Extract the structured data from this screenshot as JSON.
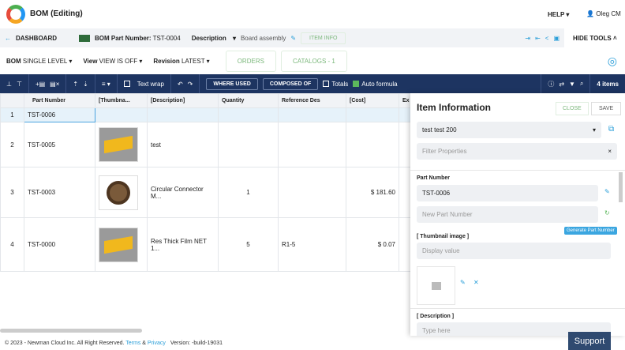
{
  "app": {
    "title": "BOM (Editing)",
    "help": "HELP",
    "user": "Oleg CM"
  },
  "nav": {
    "dashboard": "DASHBOARD",
    "bom_part_label": "BOM Part Number:",
    "bom_part_value": "TST-0004",
    "description_label": "Description",
    "description_value": "Board assembly",
    "item_info": "ITEM INFO",
    "hide_tools": "HIDE TOOLS"
  },
  "filters": {
    "bom_label": "BOM",
    "bom_value": "SINGLE LEVEL",
    "view_label": "View",
    "view_value": "VIEW IS OFF",
    "revision_label": "Revision",
    "revision_value": "LATEST",
    "orders": "ORDERS",
    "catalogs": "CATALOGS - 1"
  },
  "toolbar": {
    "text_wrap": "Text wrap",
    "where_used": "WHERE USED",
    "composed_of": "COMPOSED OF",
    "totals": "Totals",
    "auto_formula": "Auto formula",
    "items_count": "4 items"
  },
  "table": {
    "headers": [
      "",
      "Part Number",
      "[Thumbna...",
      "[Description]",
      "Quantity",
      "Reference Des",
      "[Cost]",
      "Ex"
    ],
    "rows": [
      {
        "n": "1",
        "part": "TST-0006",
        "thumb": "",
        "desc": "",
        "qty": "",
        "ref": "",
        "cost": ""
      },
      {
        "n": "2",
        "part": "TST-0005",
        "thumb": "chip",
        "desc": "test",
        "qty": "",
        "ref": "",
        "cost": ""
      },
      {
        "n": "3",
        "part": "TST-0003",
        "thumb": "connector",
        "desc": "Circular Connector M...",
        "qty": "1",
        "ref": "",
        "cost": "$ 181.60"
      },
      {
        "n": "4",
        "part": "TST-0000",
        "thumb": "chip",
        "desc": "Res Thick Film NET 1...",
        "qty": "5",
        "ref": "R1-5",
        "cost": "$ 0.07"
      }
    ]
  },
  "panel": {
    "title": "Item Information",
    "close": "CLOSE",
    "save": "SAVE",
    "selected": "test test 200",
    "filter_placeholder": "Filter Properties",
    "part_number_label": "Part Number",
    "part_number_value": "TST-0006",
    "new_part_placeholder": "New Part Number",
    "generate_tooltip": "Generate Part Number",
    "thumbnail_label": "[ Thumbnail image ]",
    "display_value_placeholder": "Display value",
    "description_label": "[ Description ]",
    "description_placeholder": "Type here"
  },
  "footer": {
    "copyright": "© 2023 - Newman Cloud Inc. All Right Reserved.",
    "terms": "Terms",
    "amp": "&",
    "privacy": "Privacy",
    "version": "Version: -build-19031",
    "support": "Support"
  }
}
